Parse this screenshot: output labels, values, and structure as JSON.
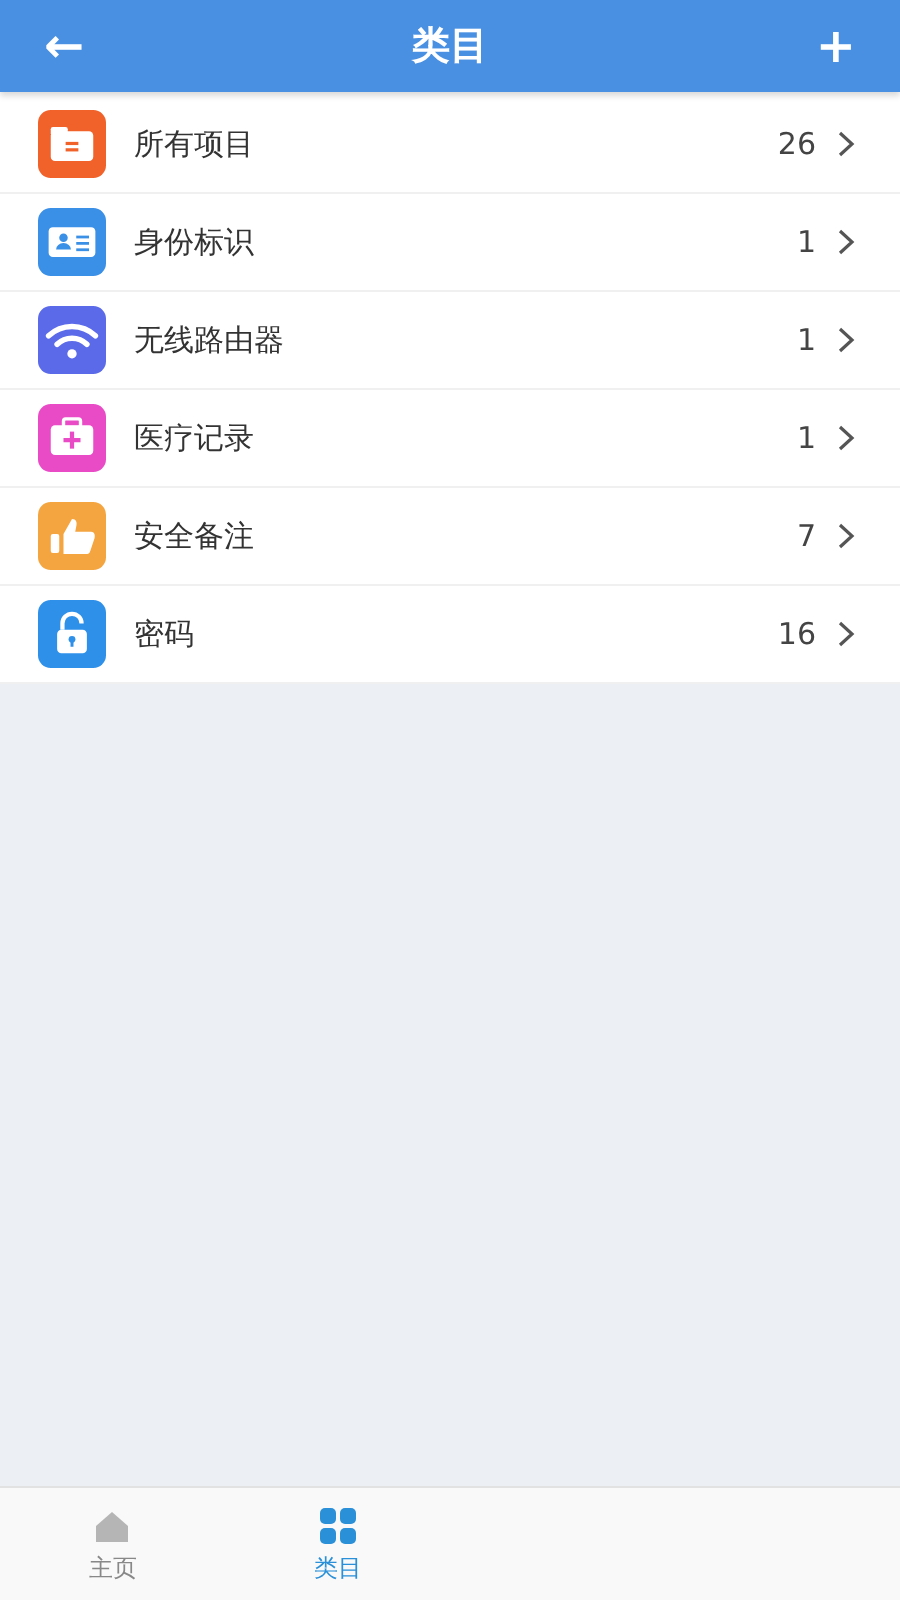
{
  "header": {
    "title": "类目",
    "back_icon": "←",
    "add_icon": "+"
  },
  "categories": [
    {
      "kind": "folder",
      "label": "所有项目",
      "count": "26",
      "color": "#f0622a"
    },
    {
      "kind": "id-card",
      "label": "身份标识",
      "count": "1",
      "color": "#3a8fe6"
    },
    {
      "kind": "wifi",
      "label": "无线路由器",
      "count": "1",
      "color": "#5a6ae8"
    },
    {
      "kind": "medical",
      "label": "医疗记录",
      "count": "1",
      "color": "#e94bc6"
    },
    {
      "kind": "thumb",
      "label": "安全备注",
      "count": "7",
      "color": "#f5a540"
    },
    {
      "kind": "lock",
      "label": "密码",
      "count": "16",
      "color": "#2f90ea"
    }
  ],
  "tab_bar": [
    {
      "kind": "home",
      "label": "主页",
      "selected": false
    },
    {
      "kind": "grid",
      "label": "类目",
      "selected": true
    }
  ]
}
